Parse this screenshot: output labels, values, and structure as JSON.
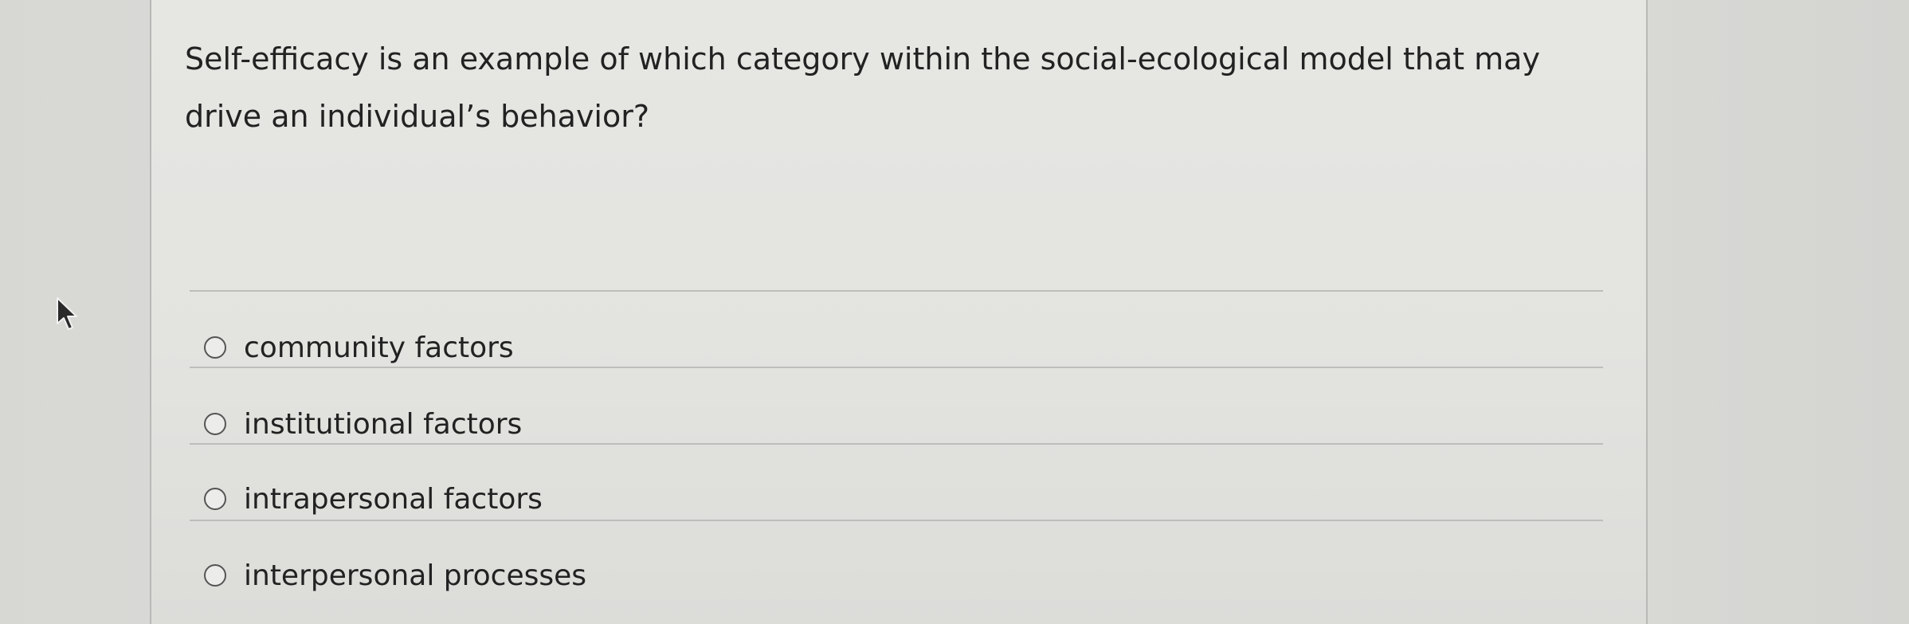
{
  "question": {
    "text": "Self-efficacy is an example of which category within the social-ecological model that may drive an individual’s behavior?"
  },
  "choices": [
    {
      "label": "community factors"
    },
    {
      "label": "institutional factors"
    },
    {
      "label": "intrapersonal factors"
    },
    {
      "label": "interpersonal processes"
    }
  ],
  "colors": {
    "panel": "#e4e4e1",
    "text": "#222222",
    "divider": "#bdbdba"
  }
}
